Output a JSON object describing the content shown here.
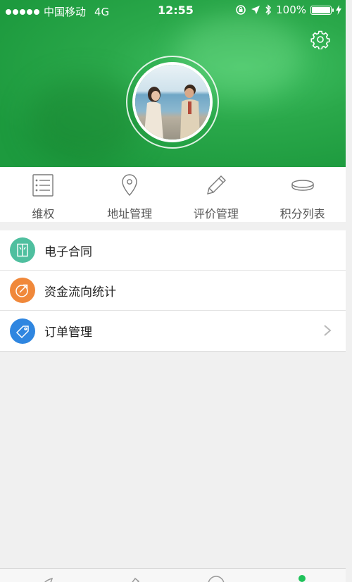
{
  "status_bar": {
    "carrier": "中国移动",
    "network": "4G",
    "time": "12:55",
    "battery": "100%"
  },
  "header": {
    "settings_icon": "gear-icon",
    "avatar": "profile-photo",
    "colors": {
      "background": "#2aa84a"
    }
  },
  "quick_nav": [
    {
      "label": "维权",
      "icon": "list-icon"
    },
    {
      "label": "地址管理",
      "icon": "location-pin-icon"
    },
    {
      "label": "评价管理",
      "icon": "pencil-icon"
    },
    {
      "label": "积分列表",
      "icon": "coin-icon"
    }
  ],
  "menu": [
    {
      "label": "电子合同",
      "icon": "contract-icon",
      "color": "#4fbf9f"
    },
    {
      "label": "资金流向统计",
      "icon": "chart-icon",
      "color": "#f0883a"
    },
    {
      "label": "订单管理",
      "icon": "tag-icon",
      "color": "#2f86e0",
      "chevron": true
    }
  ],
  "tabbar": {
    "tabs": [
      {
        "icon": "leaf-icon"
      },
      {
        "icon": "feather-icon"
      },
      {
        "icon": "chat-icon"
      },
      {
        "icon": "profile-icon",
        "active": true
      }
    ],
    "active_color": "#1fc25a"
  }
}
